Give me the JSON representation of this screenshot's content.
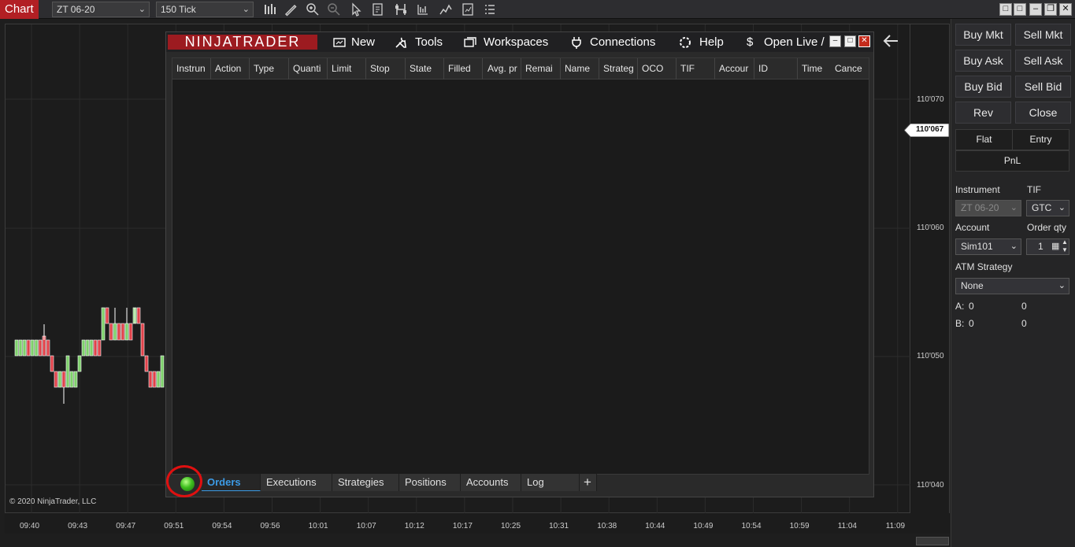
{
  "toolbar": {
    "chart_tab": "Chart",
    "instrument": "ZT 06-20",
    "interval": "150 Tick",
    "icons": [
      "bar-type-icon",
      "draw-tool-icon",
      "zoom-in-icon",
      "zoom-out-icon",
      "pointer-icon",
      "properties-icon",
      "strategies-icon",
      "indicators-icon",
      "templates-icon",
      "list-icon"
    ]
  },
  "chart": {
    "price_labels": [
      "110'070",
      "110'060",
      "110'050",
      "110'040"
    ],
    "last_price": "110'067",
    "time_labels": [
      "09:40",
      "09:43",
      "09:47",
      "09:51",
      "09:54",
      "09:56",
      "10:01",
      "10:07",
      "10:12",
      "10:17",
      "10:25",
      "10:31",
      "10:38",
      "10:44",
      "10:49",
      "10:54",
      "10:59",
      "11:04",
      "11:09"
    ],
    "copyright": "© 2020 NinjaTrader, LLC",
    "up_color": "#7ed06b",
    "down_color": "#e0424a"
  },
  "control_center": {
    "logo": "NINJATRADER",
    "menu": [
      "New",
      "Tools",
      "Workspaces",
      "Connections",
      "Help",
      "Open Live /"
    ],
    "columns": [
      "Instrun",
      "Action",
      "Type",
      "Quanti",
      "Limit",
      "Stop",
      "State",
      "Filled",
      "Avg. pr",
      "Remai",
      "Name",
      "Strateg",
      "OCO",
      "TIF",
      "Accour",
      "ID",
      "Time",
      "Cance"
    ],
    "tabs": [
      "Orders",
      "Executions",
      "Strategies",
      "Positions",
      "Accounts",
      "Log",
      "+"
    ],
    "active_tab": "Orders",
    "connection_status_color": "#3fbf1f"
  },
  "order_panel": {
    "buy_mkt": "Buy Mkt",
    "sell_mkt": "Sell Mkt",
    "buy_ask": "Buy Ask",
    "sell_ask": "Sell Ask",
    "buy_bid": "Buy Bid",
    "sell_bid": "Sell Bid",
    "rev": "Rev",
    "close": "Close",
    "flat": "Flat",
    "entry": "Entry",
    "pnl": "PnL",
    "instrument_label": "Instrument",
    "instrument_value": "ZT 06-20",
    "tif_label": "TIF",
    "tif_value": "GTC",
    "account_label": "Account",
    "account_value": "Sim101",
    "order_qty_label": "Order qty",
    "order_qty_value": "1",
    "atm_label": "ATM Strategy",
    "atm_value": "None",
    "a_label": "A:",
    "a_value1": "0",
    "a_value2": "0",
    "b_label": "B:",
    "b_value1": "0",
    "b_value2": "0"
  }
}
